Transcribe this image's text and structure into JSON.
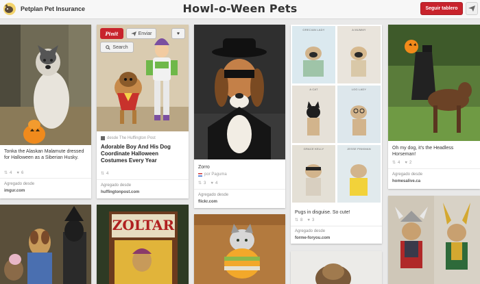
{
  "header": {
    "brand": "Petplan Pet Insurance",
    "title": "Howl-o-Ween Pets",
    "follow_label": "Seguir tablero"
  },
  "colors": {
    "accent_red": "#c8232c",
    "background": "#e9e9e9",
    "topbar": "#f7f7f7"
  },
  "hover_actions": {
    "pin_it": "Pinit",
    "send": "Enviar",
    "search": "Search",
    "like_icon": "heart-icon"
  },
  "pins": {
    "malamute": {
      "description": "Tonka the Alaskan Malamute dressed for Halloween as a Siberian Husky.",
      "repins": "4",
      "likes": "6",
      "source_label": "Agregado desde",
      "source_domain": "imgur.com"
    },
    "buzz": {
      "via": "desde The Huffington Post",
      "description": "Adorable Boy And His Dog Coordinate Halloween Costumes Every Year",
      "repins": "4",
      "source_label": "Agregado desde",
      "source_domain": "huffingtonpost.com"
    },
    "zorro": {
      "description": "Zorro",
      "via": "por Paguma",
      "repins": "3",
      "likes": "4",
      "source_label": "Agregado desde",
      "source_domain": "flickr.com"
    },
    "pugs": {
      "captions": [
        "GRECIAN LADY",
        "A MUMMY",
        "A CAT",
        "LOG LADY",
        "GRACE KELLY",
        "JESSE PINKMAN"
      ],
      "description": "Pugs in disguise. So cute!",
      "repins": "8",
      "likes": "3",
      "source_label": "Agregado desde",
      "source_domain": "forme-foryou.com"
    },
    "headless": {
      "description": "Oh my dog, it's the Headless Horseman!",
      "repins": "4",
      "likes": "2",
      "source_label": "Agregado desde",
      "source_domain": "homesalive.ca"
    },
    "zoltar": {
      "sign": "ZOLTAR"
    }
  }
}
